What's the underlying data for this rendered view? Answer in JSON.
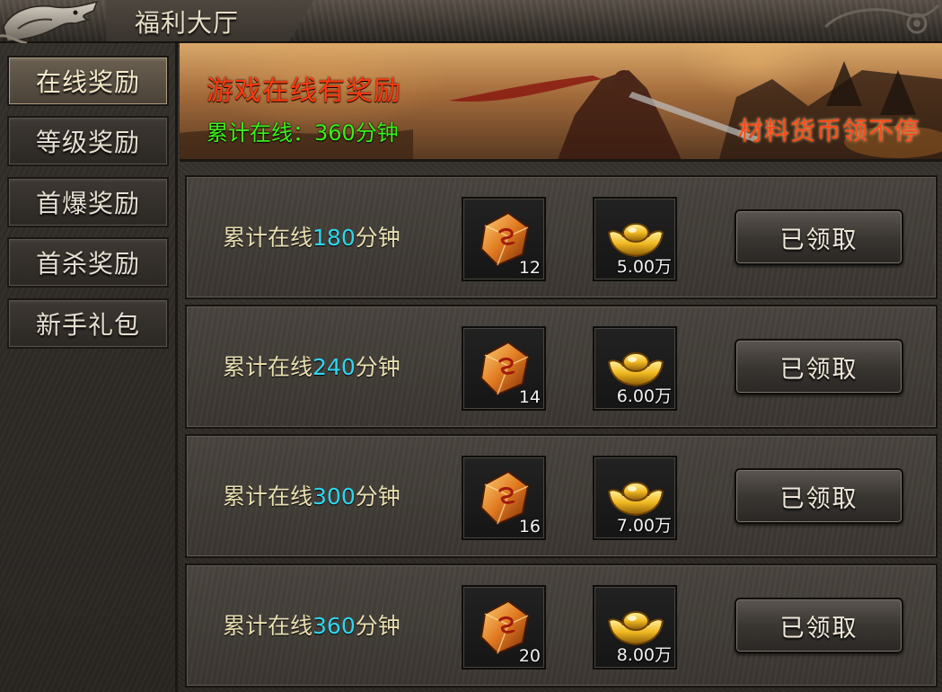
{
  "window": {
    "title": "福利大厅"
  },
  "sidebar": {
    "tabs": [
      {
        "label": "在线奖励",
        "active": true
      },
      {
        "label": "等级奖励",
        "active": false
      },
      {
        "label": "首爆奖励",
        "active": false
      },
      {
        "label": "首杀奖励",
        "active": false
      },
      {
        "label": "新手礼包",
        "active": false
      }
    ]
  },
  "banner": {
    "title": "游戏在线有奖励",
    "online_label": "累计在线：360分钟",
    "slogan": "材料货币领不停"
  },
  "rewards": [
    {
      "prefix": "累计在线",
      "minutes": "180",
      "suffix": "分钟",
      "item1_icon": "rune-stone-icon",
      "item1_count": "12",
      "item2_icon": "gold-ingot-icon",
      "item2_count": "5.00万",
      "button": "已领取"
    },
    {
      "prefix": "累计在线",
      "minutes": "240",
      "suffix": "分钟",
      "item1_icon": "rune-stone-icon",
      "item1_count": "14",
      "item2_icon": "gold-ingot-icon",
      "item2_count": "6.00万",
      "button": "已领取"
    },
    {
      "prefix": "累计在线",
      "minutes": "300",
      "suffix": "分钟",
      "item1_icon": "rune-stone-icon",
      "item1_count": "16",
      "item2_icon": "gold-ingot-icon",
      "item2_count": "7.00万",
      "button": "已领取"
    },
    {
      "prefix": "累计在线",
      "minutes": "360",
      "suffix": "分钟",
      "item1_icon": "rune-stone-icon",
      "item1_count": "20",
      "item2_icon": "gold-ingot-icon",
      "item2_count": "8.00万",
      "button": "已领取"
    }
  ],
  "colors": {
    "accent_red": "#ff3a10",
    "online_green": "#3cf01a",
    "minutes_cyan": "#2ed7ee",
    "label_cream": "#e8dfb0"
  }
}
